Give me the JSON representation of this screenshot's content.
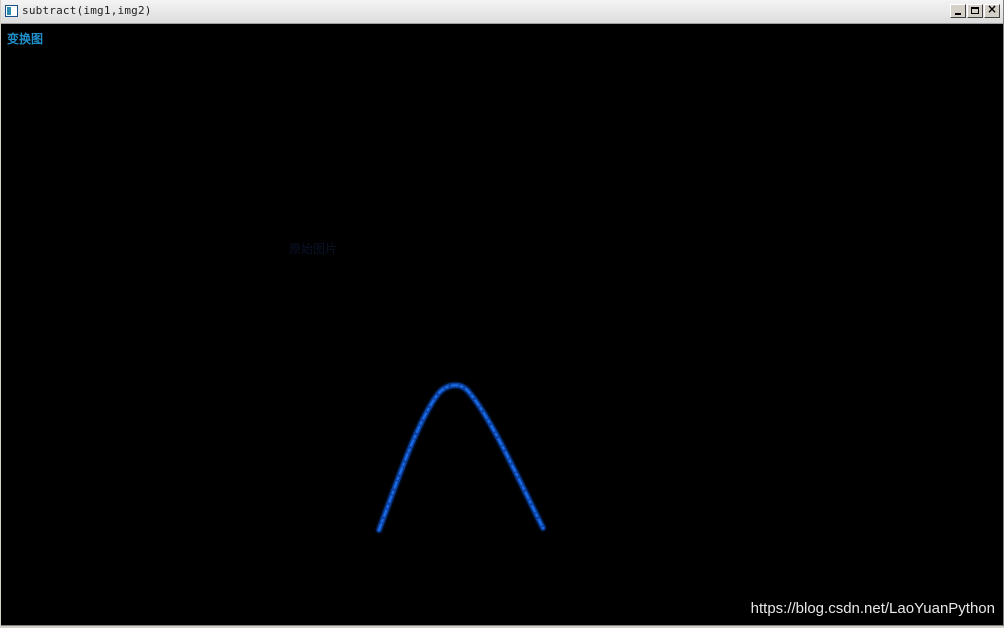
{
  "window": {
    "title": "subtract(img1,img2)",
    "icon": "app-window-icon",
    "controls": {
      "minimize": "_",
      "maximize": "□",
      "close": "×"
    }
  },
  "canvas": {
    "label_transform": "变换图",
    "label_faint": "原始图片",
    "curve": {
      "shape": "parabola-arc",
      "color": "#1a5fd8"
    }
  },
  "watermark": "https://blog.csdn.net/LaoYuanPython"
}
